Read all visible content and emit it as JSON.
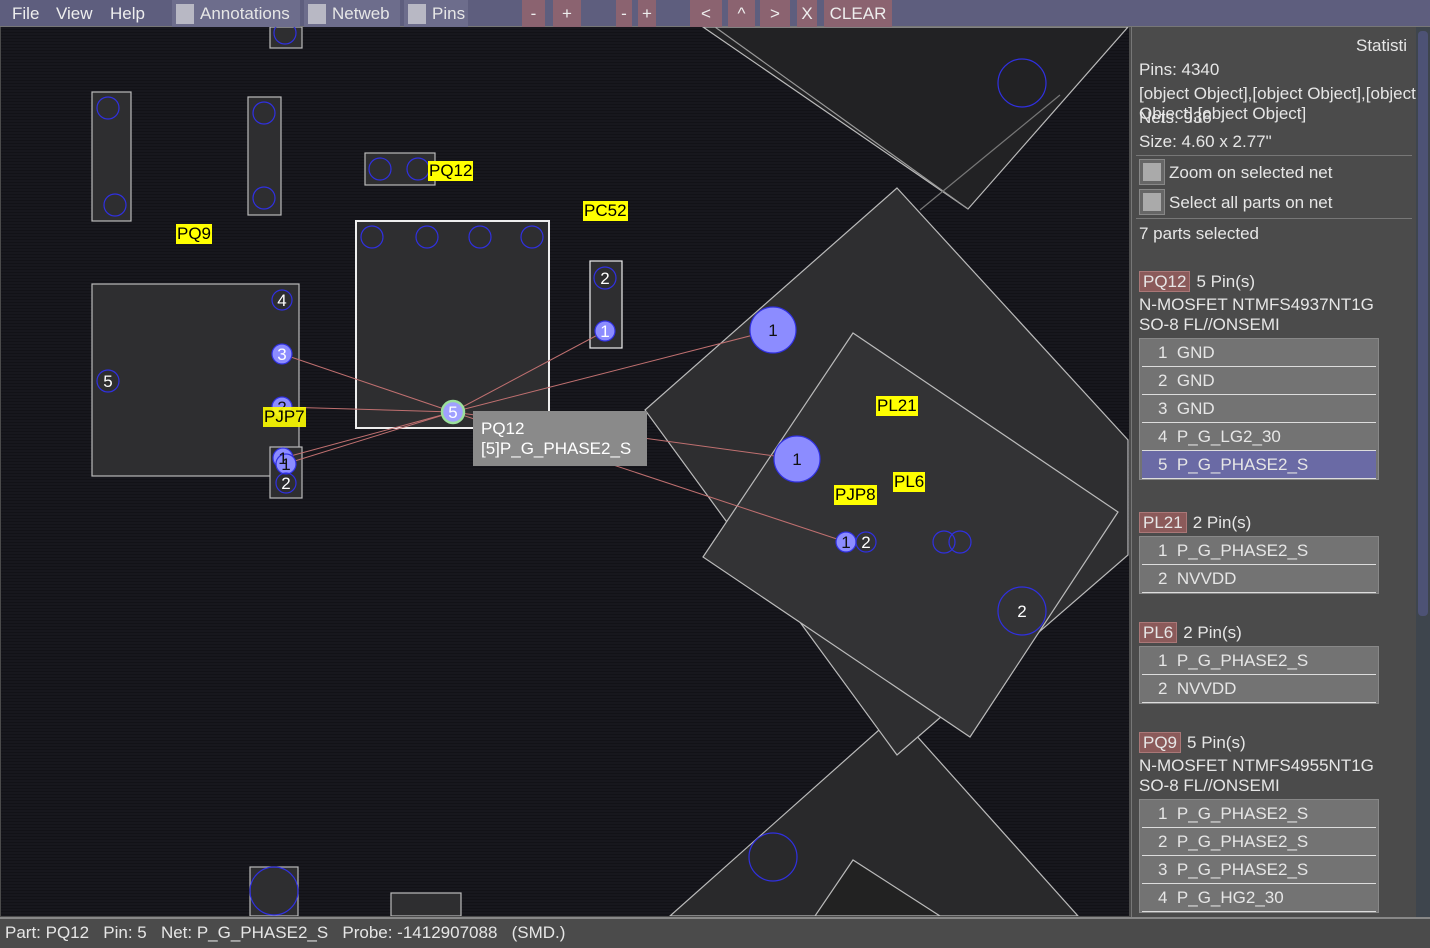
{
  "menu": {
    "file": "File",
    "view": "View",
    "help": "Help"
  },
  "toolbar": {
    "annotations": "Annotations",
    "netweb": "Netweb",
    "pins": "Pins",
    "zoom_out_1": "-",
    "zoom_in_1": "+",
    "zoom_out_2": "-",
    "zoom_in_2": "+",
    "prev": "<",
    "up": "^",
    "next": ">",
    "close": "X",
    "clear": "CLEAR"
  },
  "canvas": {
    "labels": [
      "PQ12",
      "PC52",
      "PQ9",
      "PJP7",
      "PL21",
      "PL6",
      "PJP8"
    ],
    "pins": {
      "pq9_4": "4",
      "pq9_3": "3",
      "pq9_5": "5",
      "pq9_2": "2",
      "pq9_1": "1",
      "pjp7_1": "1",
      "pjp7_2": "2",
      "pc52_2": "2",
      "pc52_1": "1",
      "pq12_5": "5",
      "pl21_1": "1",
      "pl6_1": "1",
      "pl6_2": "2",
      "pjp8_1": "1",
      "pjp8_2": "2"
    },
    "tooltip": {
      "part": "PQ12",
      "net": "[5]P_G_PHASE2_S"
    },
    "colors": {
      "label_bg": "#ffff00",
      "ratsnest": "#c07070",
      "pin_fill": "#8c8cff",
      "pin_outline": "#3030e0"
    }
  },
  "sidebar": {
    "title": "Statisti",
    "pins": "Pins: 4340",
    "parts": [
      {
        "name": "PQ12",
        "count": "5 Pin(s)",
        "desc1": "N-MOSFET NTMFS4937NT1G",
        "desc2": "SO-8 FL//ONSEMI",
        "pins": [
          "1  GND",
          "2  GND",
          "3  GND",
          "4  P_G_LG2_30",
          "5  P_G_PHASE2_S"
        ]
      },
      {
        "name": "PL21",
        "count": "2 Pin(s)",
        "pins": [
          "1  P_G_PHASE2_S",
          "2  NVVDD"
        ]
      },
      {
        "name": "PL6",
        "count": "2 Pin(s)",
        "pins": [
          "1  P_G_PHASE2_S",
          "2  NVVDD"
        ]
      },
      {
        "name": "PQ9",
        "count": "5 Pin(s)",
        "desc1": "N-MOSFET NTMFS4955NT1G",
        "desc2": "SO-8 FL//ONSEMI",
        "pins": [
          "1  P_G_PHASE2_S",
          "2  P_G_PHASE2_S",
          "3  P_G_PHASE2_S",
          "4  P_G_HG2_30"
        ]
      }
    ],
    "nets": "Nets: 936",
    "size": "Size: 4.60 x 2.77\"",
    "zoom_net": "Zoom on selected net",
    "select_all": "Select all parts on net",
    "selected": "7 parts selected"
  },
  "status": {
    "part": "Part: PQ12",
    "pin": "Pin: 5",
    "net": "Net: P_G_PHASE2_S",
    "probe": "Probe: -1412907088",
    "type": "(SMD.)"
  }
}
